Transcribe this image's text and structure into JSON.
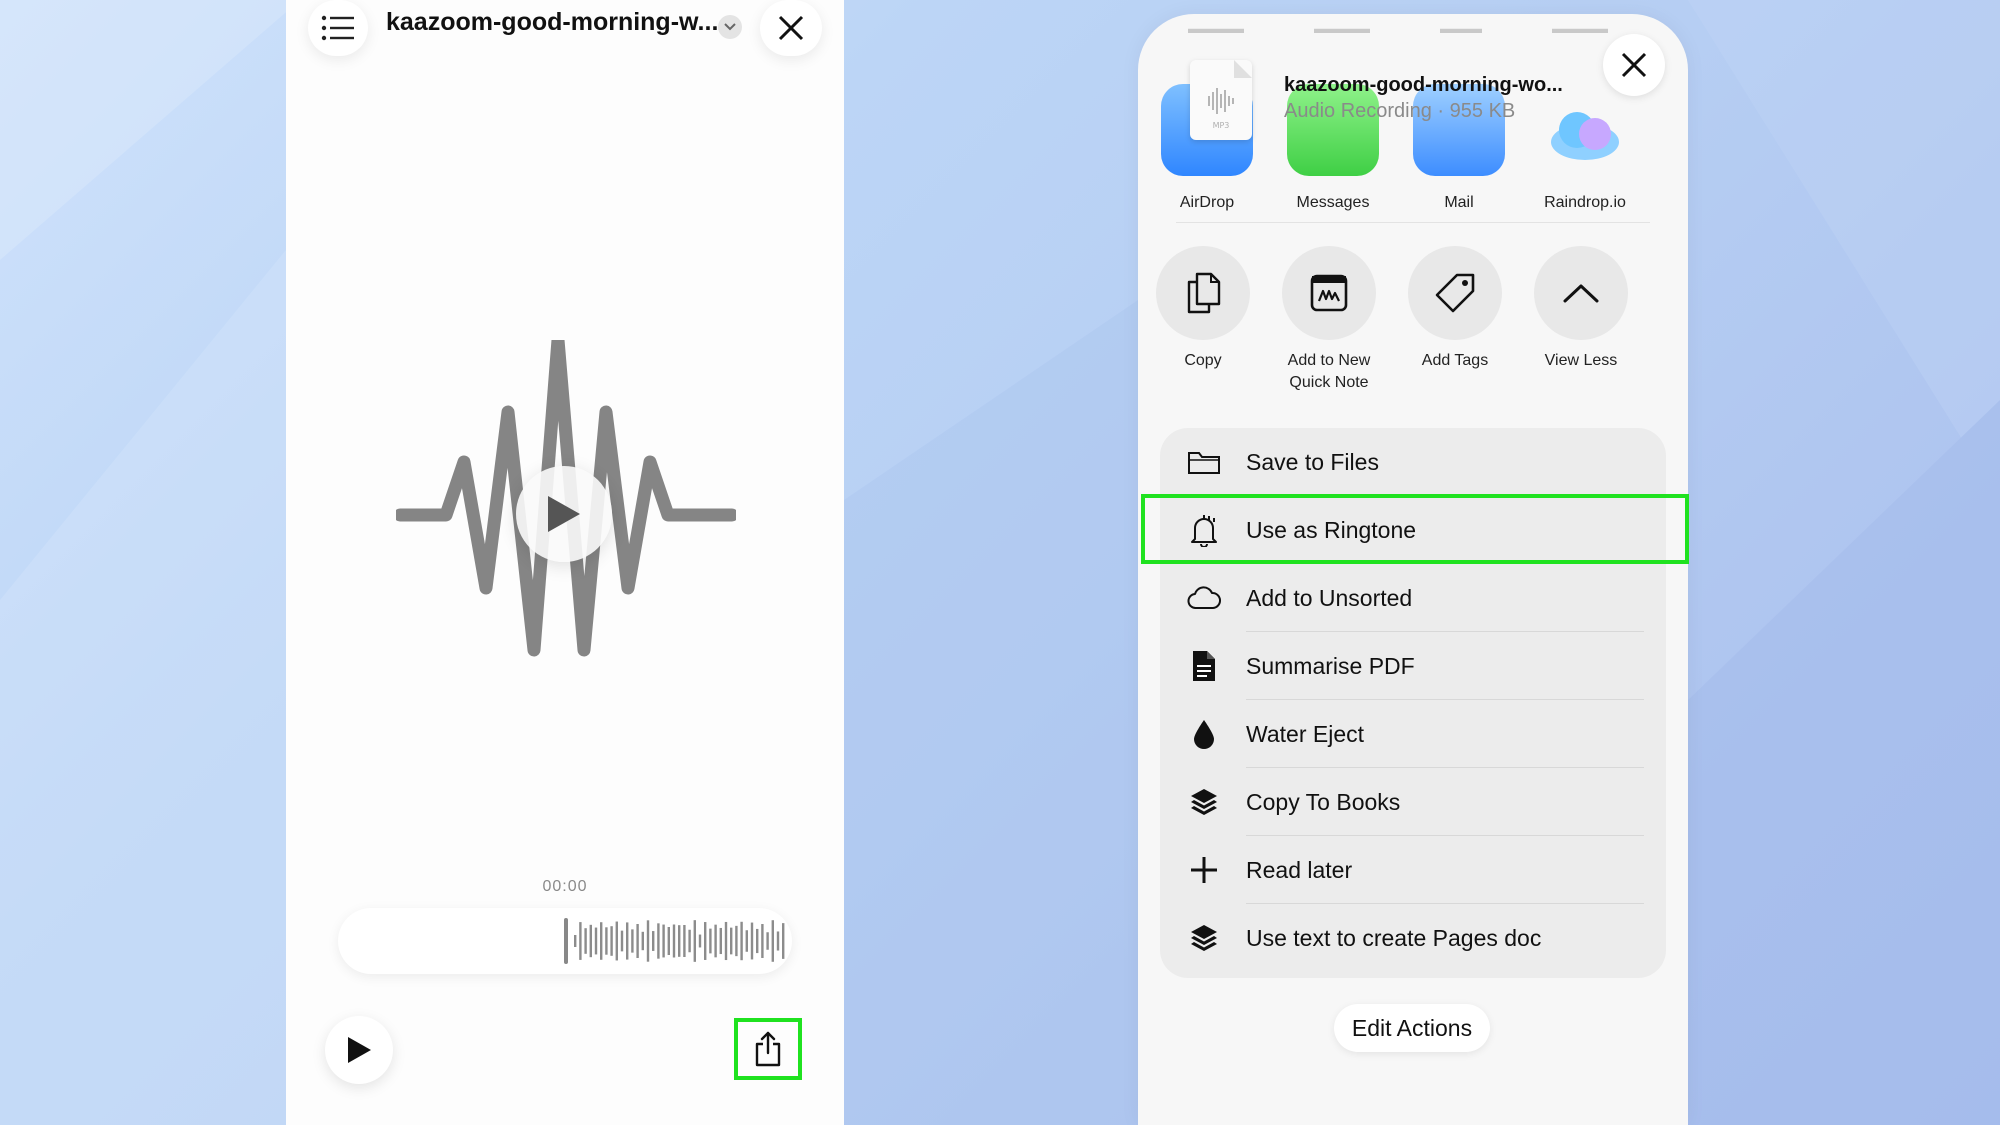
{
  "player": {
    "title": "kaazoom-good-morning-w...",
    "time": "00:00"
  },
  "share_sheet": {
    "file_name": "kaazoom-good-morning-wo...",
    "file_meta": "Audio Recording · 955 KB",
    "file_type_badge": "MP3",
    "apps": [
      {
        "label": "AirDrop",
        "icon": "airdrop-icon"
      },
      {
        "label": "Messages",
        "icon": "messages-icon"
      },
      {
        "label": "Mail",
        "icon": "mail-icon"
      },
      {
        "label": "Raindrop.io",
        "icon": "raindrop-icon"
      }
    ],
    "actions": [
      {
        "label": "Copy",
        "icon": "copy-icon"
      },
      {
        "label": "Add to New Quick Note",
        "icon": "quick-note-icon"
      },
      {
        "label": "Add Tags",
        "icon": "tag-icon"
      },
      {
        "label": "View Less",
        "icon": "chevron-up-icon"
      }
    ],
    "list": [
      {
        "label": "Save to Files",
        "icon": "folder-icon"
      },
      {
        "label": "Use as Ringtone",
        "icon": "bell-icon"
      },
      {
        "label": "Add to Unsorted",
        "icon": "cloud-icon"
      },
      {
        "label": "Summarise PDF",
        "icon": "document-icon"
      },
      {
        "label": "Water Eject",
        "icon": "drop-icon"
      },
      {
        "label": "Copy To Books",
        "icon": "shortcuts-layers-icon"
      },
      {
        "label": "Read later",
        "icon": "plus-icon"
      },
      {
        "label": "Use text to create Pages doc",
        "icon": "shortcuts-layers-icon"
      }
    ],
    "edit_actions": "Edit Actions"
  },
  "colors": {
    "highlight": "#1fe21f",
    "background": "#bcd5f6"
  }
}
